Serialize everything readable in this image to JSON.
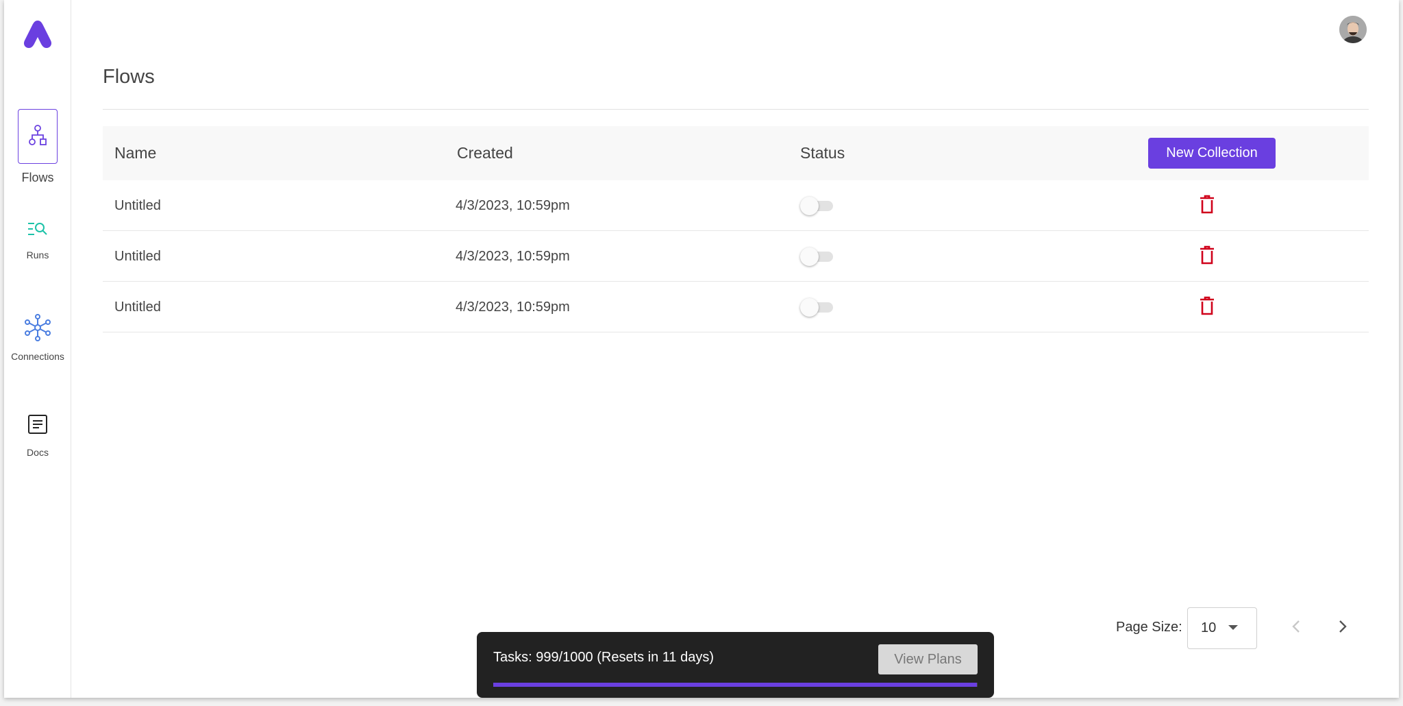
{
  "sidebar": {
    "items": [
      {
        "label": "Flows",
        "icon": "flows-icon",
        "active": true
      },
      {
        "label": "Runs",
        "icon": "runs-search-icon",
        "active": false
      },
      {
        "label": "Connections",
        "icon": "connections-icon",
        "active": false
      },
      {
        "label": "Docs",
        "icon": "docs-icon",
        "active": false
      }
    ]
  },
  "header": {
    "avatar": "user-avatar"
  },
  "page": {
    "title": "Flows"
  },
  "table": {
    "columns": [
      "Name",
      "Created",
      "Status"
    ],
    "new_collection_label": "New Collection",
    "rows": [
      {
        "name": "Untitled",
        "created": "4/3/2023, 10:59pm",
        "status_on": false
      },
      {
        "name": "Untitled",
        "created": "4/3/2023, 10:59pm",
        "status_on": false
      },
      {
        "name": "Untitled",
        "created": "4/3/2023, 10:59pm",
        "status_on": false
      }
    ]
  },
  "pagination": {
    "page_size_label": "Page Size:",
    "page_size_value": "10"
  },
  "tasks": {
    "text": "Tasks: 999/1000 (Resets in 11 days)",
    "used": 999,
    "limit": 1000,
    "view_plans_label": "View Plans"
  },
  "colors": {
    "accent": "#6a3fe0",
    "delete": "#d0021b",
    "runs_icon": "#1cc2a8",
    "connections_icon": "#4a7de0"
  }
}
